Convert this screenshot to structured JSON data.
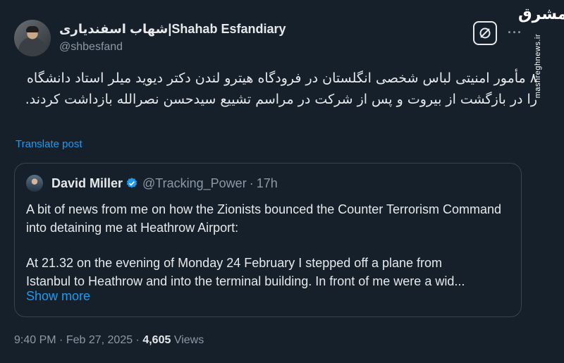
{
  "author": {
    "display_name": "شهاب اسفندیاری|Shahab Esfandiary",
    "handle": "@shbesfand"
  },
  "header": {
    "more_label": "···",
    "brand_logo": "مشرق",
    "brand_site": "mashreghnews.ir"
  },
  "post": {
    "text": "۸ مأمور امنیتی لباس شخصی انگلستان در فرودگاه هیترو لندن دکتر دیوید میلر استاد دانشگاه را در بازگشت از بیروت و پس از شرکت در مراسم تشییع سیدحسن نصرالله بازداشت کردند.",
    "translate_label": "Translate post"
  },
  "quote": {
    "name": "David Miller",
    "handle": "@Tracking_Power",
    "separator": "·",
    "time": "17h",
    "paragraph1": "A bit of news from me on how the Zionists bounced the Counter Terrorism Command into detaining me at Heathrow Airport:",
    "paragraph2_line1": "At 21.32 on the evening of Monday 24 February I stepped off a plane from",
    "paragraph2_line2": "Istanbul to Heathrow and into the terminal building.  In front of me were a wid...",
    "show_more_label": "Show more"
  },
  "meta": {
    "time": "9:40 PM",
    "sep1": " · ",
    "date": "Feb 27, 2025",
    "sep2": " · ",
    "views_count": "4,605",
    "views_label": " Views"
  },
  "colors": {
    "background": "#15202b",
    "text": "#e7e9ea",
    "muted": "#8b98a5",
    "link": "#1d9bf0",
    "border": "#38444d"
  }
}
